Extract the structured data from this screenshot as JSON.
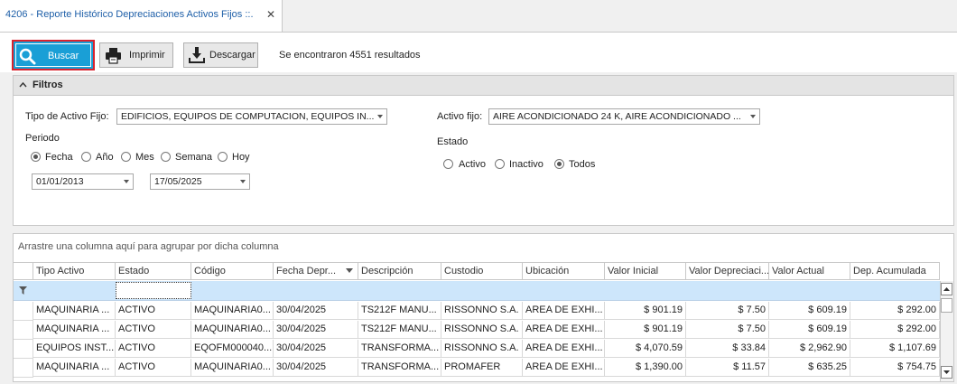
{
  "tab": {
    "title": "4206 - Reporte Histórico Depreciaciones Activos Fijos ::.",
    "close": "✕"
  },
  "toolbar": {
    "buscar": "Buscar",
    "imprimir": "Imprimir",
    "descargar": "Descargar",
    "results": "Se encontraron 4551 resultados"
  },
  "filters": {
    "title": "Filtros",
    "tipo_label": "Tipo de Activo Fijo:",
    "tipo_value": "EDIFICIOS, EQUIPOS DE COMPUTACION, EQUIPOS IN...",
    "activo_label": "Activo fijo:",
    "activo_value": "AIRE ACONDICIONADO 24 K, AIRE ACONDICIONADO ...",
    "periodo_label": "Periodo",
    "periodo_options": [
      "Fecha",
      "Año",
      "Mes",
      "Semana",
      "Hoy"
    ],
    "periodo_selected": "Fecha",
    "date_from": "01/01/2013",
    "date_to": "17/05/2025",
    "estado_label": "Estado",
    "estado_options": [
      "Activo",
      "Inactivo",
      "Todos"
    ],
    "estado_selected": "Todos"
  },
  "grid": {
    "group_hint": "Arrastre una columna aquí para agrupar por dicha columna",
    "columns": [
      "Tipo Activo",
      "Estado",
      "Código",
      "Fecha Depr...",
      "Descripción",
      "Custodio",
      "Ubicación",
      "Valor Inicial",
      "Valor Depreciaci...",
      "Valor Actual",
      "Dep. Acumulada"
    ],
    "rows": [
      [
        "MAQUINARIA ...",
        "ACTIVO",
        "MAQUINARIA0...",
        "30/04/2025",
        "TS212F MANU...",
        "RISSONNO S.A.",
        "AREA DE EXHI...",
        "$ 901.19",
        "$ 7.50",
        "$ 609.19",
        "$ 292.00"
      ],
      [
        "MAQUINARIA ...",
        "ACTIVO",
        "MAQUINARIA0...",
        "30/04/2025",
        "TS212F MANU...",
        "RISSONNO S.A.",
        "AREA DE EXHI...",
        "$ 901.19",
        "$ 7.50",
        "$ 609.19",
        "$ 292.00"
      ],
      [
        "EQUIPOS INST...",
        "ACTIVO",
        "EQOFM000040...",
        "30/04/2025",
        "TRANSFORMA...",
        "RISSONNO S.A.",
        "AREA DE EXHI...",
        "$ 4,070.59",
        "$ 33.84",
        "$ 2,962.90",
        "$ 1,107.69"
      ],
      [
        "MAQUINARIA ...",
        "ACTIVO",
        "MAQUINARIA0...",
        "30/04/2025",
        "TRANSFORMA...",
        "PROMAFER",
        "AREA DE EXHI...",
        "$ 1,390.00",
        "$ 11.57",
        "$ 635.25",
        "$ 754.75"
      ]
    ]
  }
}
